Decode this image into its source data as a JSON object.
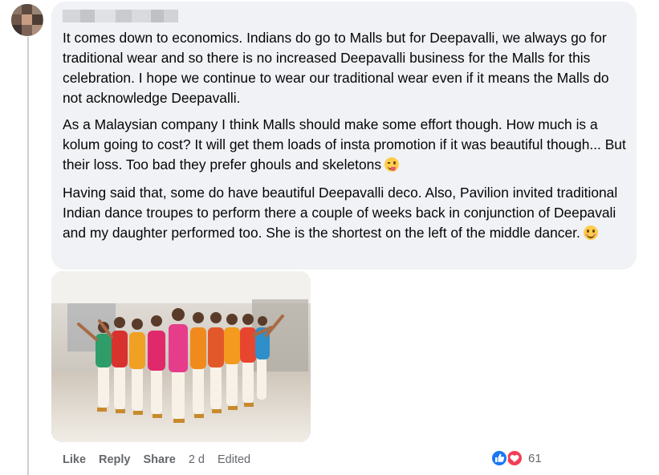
{
  "comment": {
    "paragraphs": [
      "It comes down to economics. Indians do go to Malls but for Deepavalli, we always go for traditional wear and so there is no increased Deepavalli business for the Malls for this celebration. I hope we continue to wear our traditional wear even if it means the Malls do not acknowledge Deepavalli.",
      "As a Malaysian company I think Malls should make some effort though. How much is a kolum going to cost? It will get them loads of insta promotion if it was beautiful though... But their loss. Too bad they prefer ghouls and skeletons",
      "Having said that, some do have beautiful Deepavalli deco. Also, Pavilion invited traditional Indian dance troupes to perform there a couple of weeks back in conjunction of Deepavali and my daughter performed too. She is the shortest on the left of the middle dancer."
    ],
    "emojis": [
      "winking-tongue-face-emoji",
      "smiling-face-emoji"
    ],
    "photo_icon": "dance-troupe-photo"
  },
  "actions": {
    "like": "Like",
    "reply": "Reply",
    "share": "Share",
    "time": "2 d",
    "edited": "Edited"
  },
  "reactions": {
    "icons": [
      "like-reaction-icon",
      "love-reaction-icon"
    ],
    "count": "61",
    "like_color": "#1877f2",
    "love_color": "#f33e58"
  }
}
